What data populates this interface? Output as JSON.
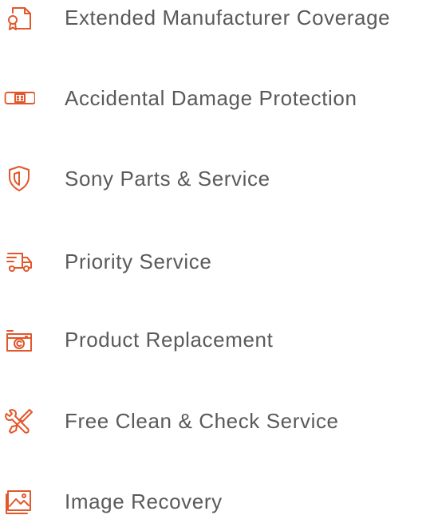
{
  "theme": {
    "icon_color": "#e2572b",
    "text_color": "#5a5a5a"
  },
  "benefits": [
    {
      "label": "Extended Manufacturer Coverage",
      "icon": "certificate-icon"
    },
    {
      "label": "Accidental Damage Protection",
      "icon": "bandage-icon"
    },
    {
      "label": "Sony Parts & Service",
      "icon": "shield-icon"
    },
    {
      "label": "Priority Service",
      "icon": "fast-truck-icon"
    },
    {
      "label": "Product Replacement",
      "icon": "camera-icon"
    },
    {
      "label": "Free Clean & Check Service",
      "icon": "tools-icon"
    },
    {
      "label": "Image Recovery",
      "icon": "image-icon"
    }
  ]
}
